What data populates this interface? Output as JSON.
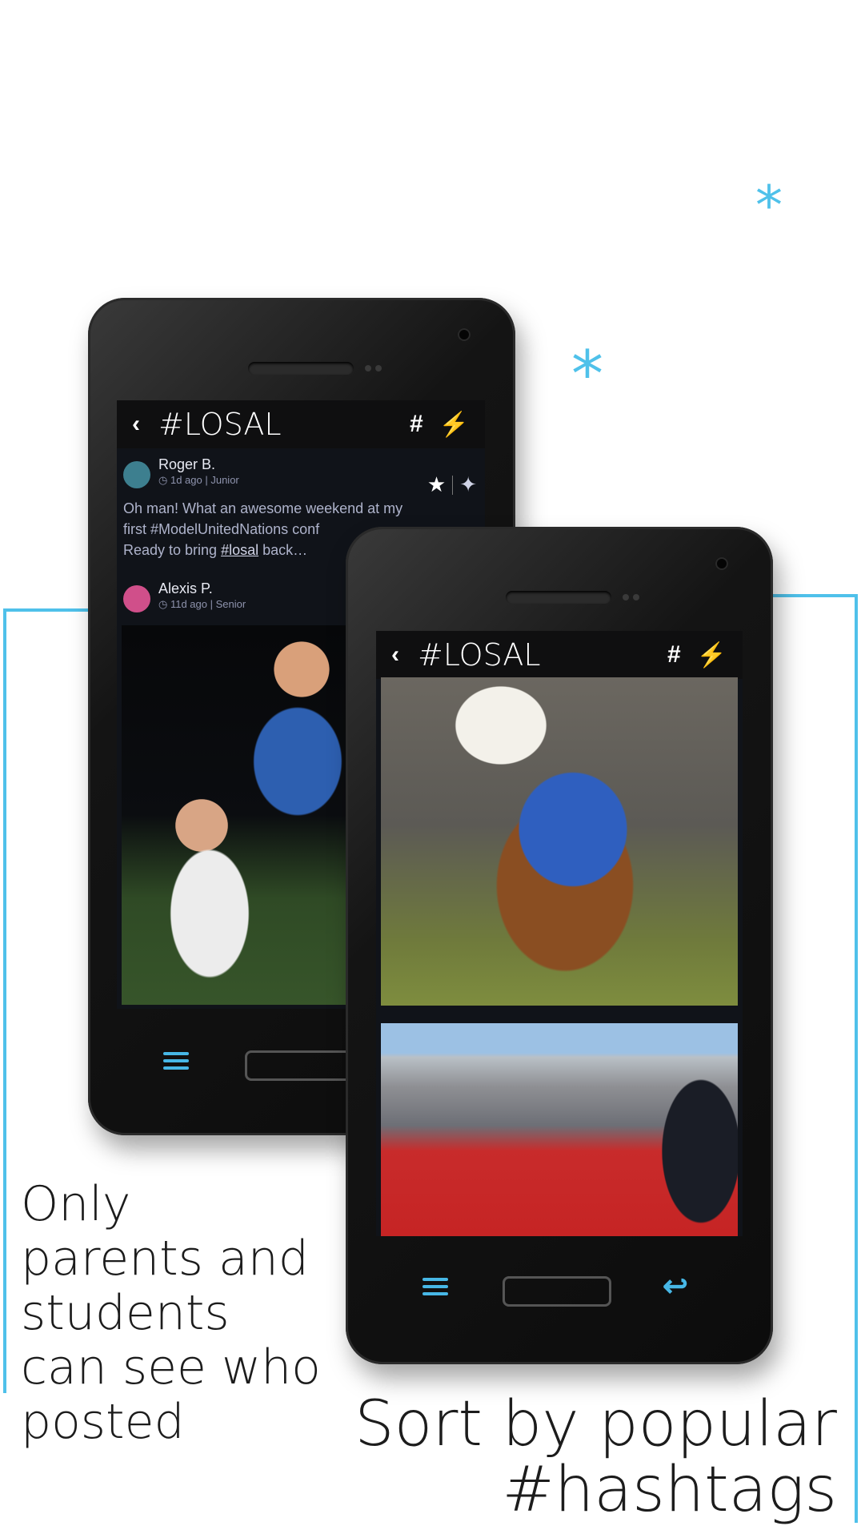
{
  "captions": {
    "left": "Only parents and students can see who posted",
    "right": "Sort by popular #hashtags"
  },
  "colors": {
    "accent": "#4fc1ea",
    "phone_body": "#0c0c0c",
    "app_bar": "#0f0f10"
  },
  "decor": {
    "asterisk": "*"
  },
  "phone_back": {
    "app_bar": {
      "title": "#LOSAL",
      "back_icon": "chevron-left-icon",
      "hashtag_icon": "hashtag-icon",
      "trending_icon": "lightning-bolt-icon"
    },
    "posts": [
      {
        "author": "Roger B.",
        "time": "1d ago",
        "grade": "Junior",
        "text_lines": [
          "Oh man! What an awesome weekend at my",
          "first #ModelUnitedNations conf",
          "Ready to bring ",
          "#losal",
          " back…"
        ],
        "actions": [
          "star-icon",
          "twitter-icon"
        ]
      },
      {
        "author": "Alexis P.",
        "time": "11d ago",
        "grade": "Senior",
        "image": "photo-coach-carried-by-players"
      }
    ],
    "nav": {
      "menu_icon": "menu-icon"
    }
  },
  "phone_front": {
    "app_bar": {
      "title": "#LOSAL",
      "back_icon": "chevron-left-icon",
      "hashtag_icon": "hashtag-icon",
      "trending_icon": "lightning-bolt-icon"
    },
    "images": [
      "photo-eagle-mascot-crowd",
      "photo-graduation-ceremony"
    ],
    "nav": {
      "menu_icon": "menu-icon",
      "back_icon": "return-arrow-icon"
    }
  }
}
